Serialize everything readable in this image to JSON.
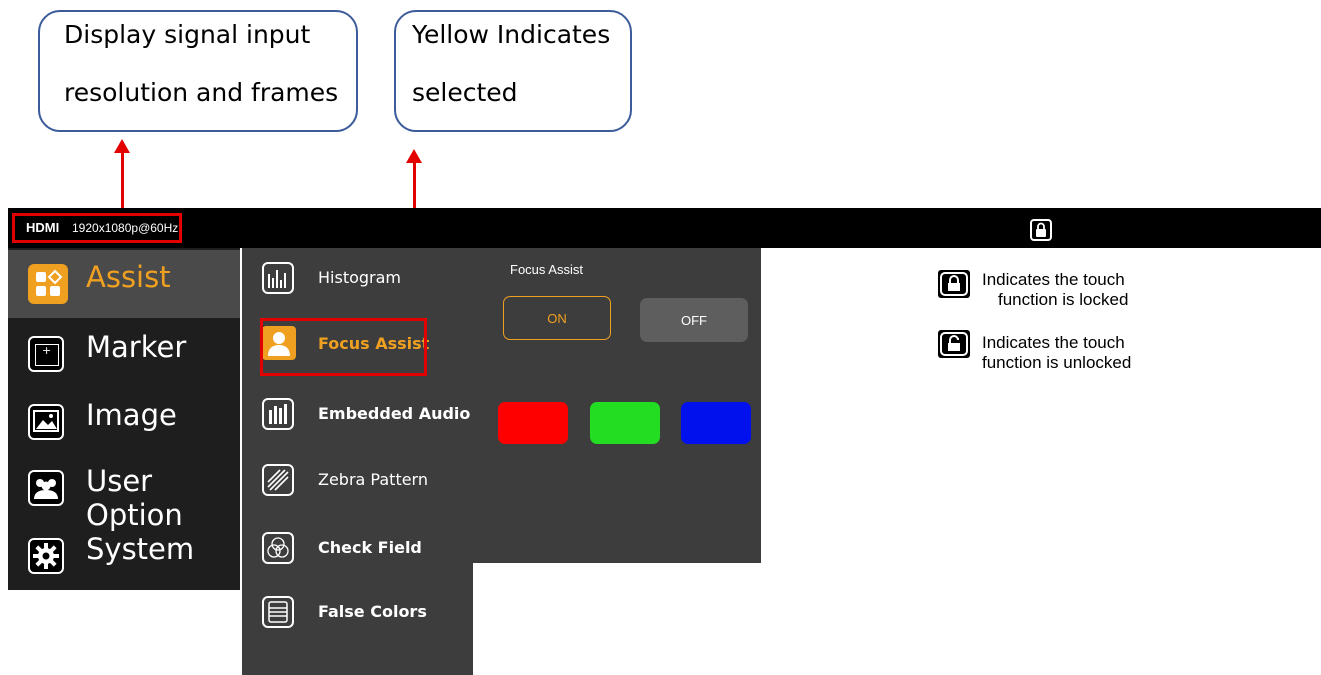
{
  "callouts": {
    "left": {
      "line1": "Display signal input",
      "line2": "resolution and frames"
    },
    "right": {
      "line1": "Yellow Indicates",
      "line2": "selected"
    }
  },
  "topbar": {
    "source": "HDMI",
    "resolution": "1920x1080p@60Hz",
    "lock_icon": "lock-icon"
  },
  "left_menu": [
    {
      "label": "Assist",
      "icon": "assist-icon"
    },
    {
      "label": "Marker",
      "icon": "marker-icon"
    },
    {
      "label": "Image",
      "icon": "image-icon"
    },
    {
      "label": "User Option",
      "icon": "user-option-icon"
    },
    {
      "label": "System",
      "icon": "gear-icon"
    }
  ],
  "sub_menu": [
    {
      "label": "Histogram",
      "icon": "histogram-icon"
    },
    {
      "label": "Focus Assist",
      "icon": "focus-assist-icon"
    },
    {
      "label": "Embedded Audio",
      "icon": "audio-meter-icon"
    },
    {
      "label": "Zebra Pattern",
      "icon": "zebra-icon"
    },
    {
      "label": "Check Field",
      "icon": "check-field-icon"
    },
    {
      "label": "False Colors",
      "icon": "false-colors-icon"
    }
  ],
  "detail": {
    "title": "Focus Assist",
    "on_label": "ON",
    "off_label": "OFF",
    "colors": [
      "#ff0000",
      "#22dd22",
      "#0011ee"
    ]
  },
  "legend": {
    "locked": {
      "line1": "Indicates the touch",
      "line2": "function is locked"
    },
    "unlocked": {
      "line1": "Indicates the touch",
      "line2": "function is unlocked"
    }
  },
  "theme": {
    "accent": "#f0a020",
    "highlight": "#e30000"
  }
}
